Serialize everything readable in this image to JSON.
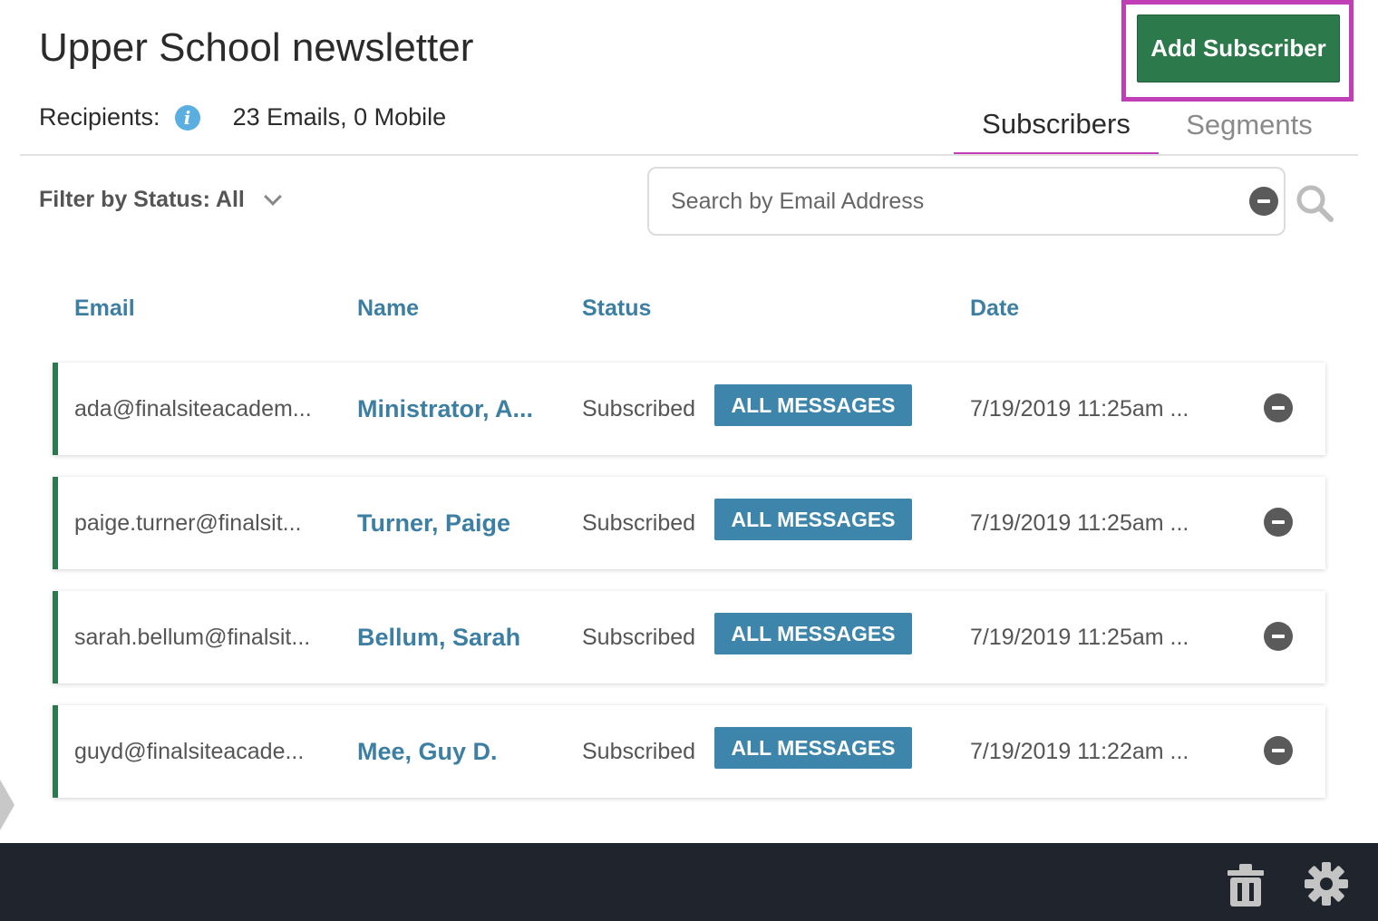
{
  "header": {
    "title": "Upper School newsletter",
    "recipients_label": "Recipients:",
    "recipients_value": "23 Emails, 0 Mobile",
    "add_button_label": "Add Subscriber"
  },
  "tabs": [
    {
      "label": "Subscribers",
      "active": true
    },
    {
      "label": "Segments",
      "active": false
    }
  ],
  "filter": {
    "label": "Filter by Status: All"
  },
  "search": {
    "placeholder": "Search by Email Address",
    "value": ""
  },
  "table": {
    "columns": [
      "Email",
      "Name",
      "Status",
      "Date"
    ],
    "rows": [
      {
        "email": "ada@finalsiteacadem...",
        "name": "Ministrator, A...",
        "status": "Subscribed",
        "badge": "ALL MESSAGES",
        "date": "7/19/2019 11:25am ..."
      },
      {
        "email": "paige.turner@finalsit...",
        "name": "Turner, Paige",
        "status": "Subscribed",
        "badge": "ALL MESSAGES",
        "date": "7/19/2019 11:25am ..."
      },
      {
        "email": "sarah.bellum@finalsit...",
        "name": "Bellum, Sarah",
        "status": "Subscribed",
        "badge": "ALL MESSAGES",
        "date": "7/19/2019 11:25am ..."
      },
      {
        "email": "guyd@finalsiteacade...",
        "name": "Mee, Guy D.",
        "status": "Subscribed",
        "badge": "ALL MESSAGES",
        "date": "7/19/2019 11:22am ..."
      }
    ]
  },
  "icons": {
    "info": "info-icon",
    "filter_chevron": "chevron-down-icon",
    "search_clear": "minus-circle-icon",
    "search": "search-icon",
    "row_remove": "minus-circle-icon",
    "footer": [
      "trash-icon",
      "gear-icon"
    ]
  },
  "colors": {
    "primary_button": "#2c7a4b",
    "highlight": "#c03fb7",
    "link_blue": "#3d7fa3",
    "badge_blue": "#3d85aa",
    "row_accent": "#2c7a4b",
    "footer_bar": "#20242d"
  }
}
